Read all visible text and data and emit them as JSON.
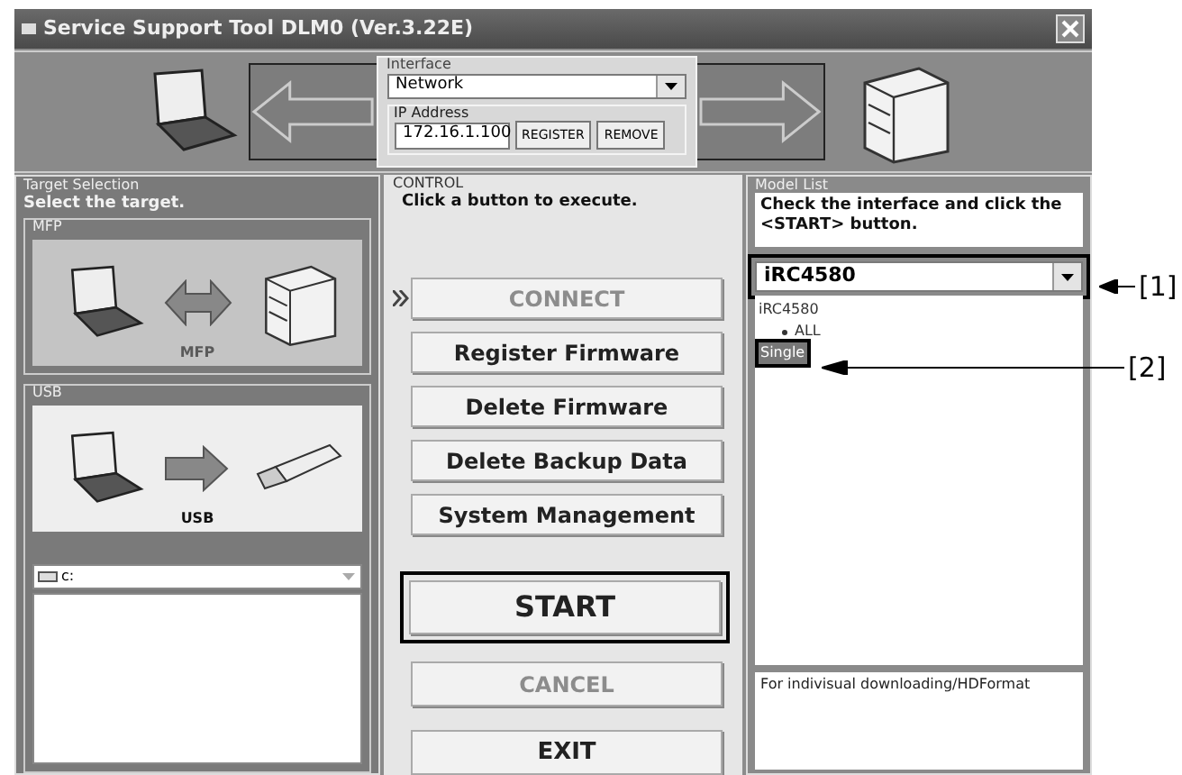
{
  "window": {
    "title": "Service Support Tool DLM0 (Ver.3.22E)"
  },
  "interface": {
    "label": "Interface",
    "value": "Network",
    "ip_label": "IP Address",
    "ip_value": "172.16.1.100",
    "buttons": [
      "REGISTER",
      "REMOVE"
    ]
  },
  "target_selection": {
    "label": "Target Selection",
    "instruction": "Select the target.",
    "targets": [
      {
        "label": "MFP",
        "caption": "MFP",
        "kind": "mfp",
        "selected": false
      },
      {
        "label": "USB",
        "caption": "USB",
        "kind": "usb",
        "selected": true
      }
    ],
    "drive": {
      "value": "c:"
    }
  },
  "control": {
    "label": "CONTROL",
    "instruction": "Click a button to execute.",
    "buttons": [
      {
        "label": "CONNECT",
        "kind": "step",
        "disabled": true,
        "current": true,
        "outlined": false
      },
      {
        "label": "Register Firmware",
        "kind": "step",
        "disabled": false,
        "current": false,
        "outlined": false
      },
      {
        "label": "Delete Firmware",
        "kind": "step",
        "disabled": false,
        "current": false,
        "outlined": false
      },
      {
        "label": "Delete Backup Data",
        "kind": "step",
        "disabled": false,
        "current": false,
        "outlined": false
      },
      {
        "label": "System Management",
        "kind": "step",
        "disabled": false,
        "current": false,
        "outlined": false
      },
      {
        "label": "START",
        "kind": "start",
        "disabled": false,
        "current": false,
        "outlined": true
      },
      {
        "label": "CANCEL",
        "kind": "cancel",
        "disabled": true,
        "current": false,
        "outlined": false
      },
      {
        "label": "EXIT",
        "kind": "exit",
        "disabled": false,
        "current": false,
        "outlined": false
      }
    ]
  },
  "model_list": {
    "label": "Model List",
    "instruction": "Check the interface and click the <START> button.",
    "model": "iRC4580",
    "tree": {
      "label": "iRC4580",
      "children": [
        {
          "label": "ALL",
          "selected": false,
          "bullet": true
        },
        {
          "label": "Single",
          "selected": true
        }
      ]
    },
    "description": "For indivisual downloading/HDFormat"
  },
  "callouts": [
    {
      "label": "[1]"
    },
    {
      "label": "[2]"
    }
  ]
}
